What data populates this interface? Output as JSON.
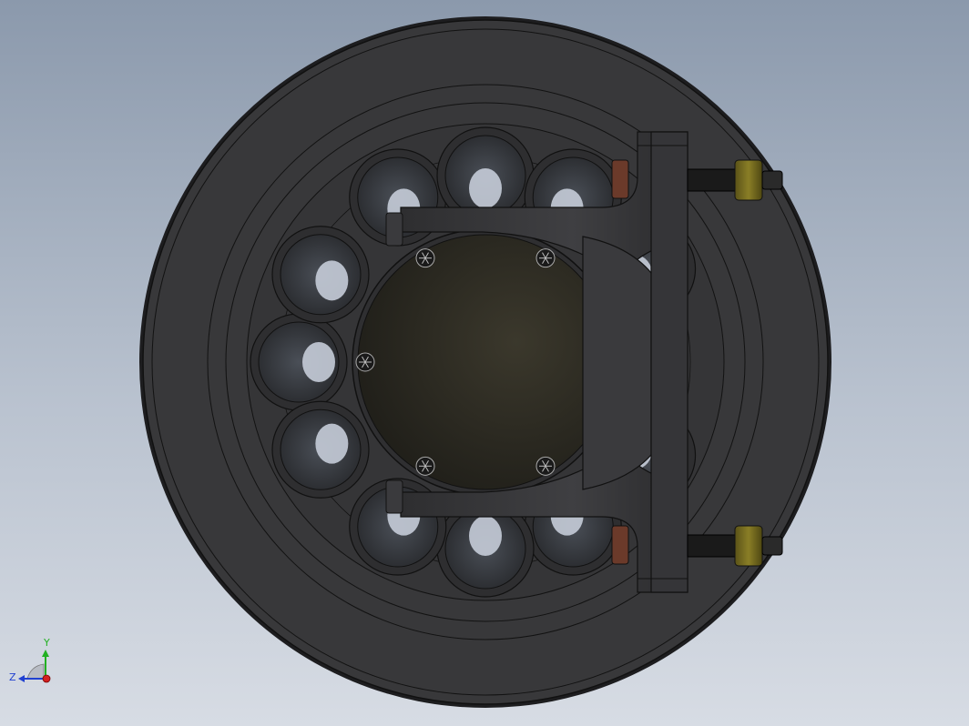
{
  "triad": {
    "y_label": "Y",
    "z_label": "Z"
  },
  "colors": {
    "background_top": "#8b99ac",
    "background_bottom": "#d7dce4",
    "wheel": "#39393b",
    "wheel_edge": "#141414",
    "hub": "#2a2820",
    "caliper": "#3a3a3d",
    "nut": "#7a7020",
    "pad_nut": "#6b3a2a",
    "axis_x": "#d42020",
    "axis_y": "#22b022",
    "axis_z": "#2040d0"
  },
  "scene": {
    "viewed_part": "wheel-with-brake-caliper",
    "view": "front"
  }
}
